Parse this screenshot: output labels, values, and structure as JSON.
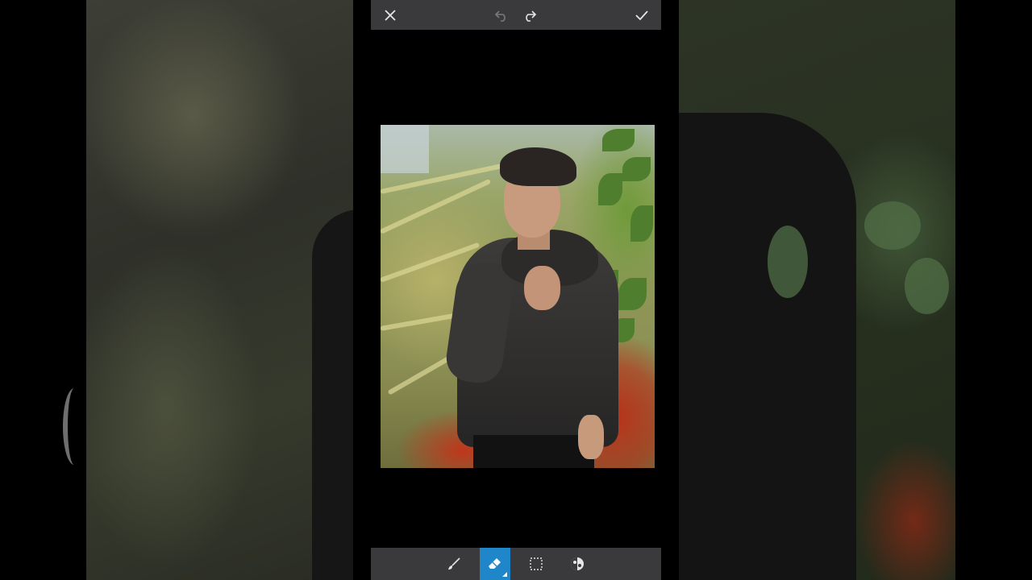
{
  "app": {
    "accent_color": "#1e86c9",
    "toolbar_color": "#3a3a3c"
  },
  "top_toolbar": {
    "close": {
      "icon": "close-icon"
    },
    "undo": {
      "icon": "undo-icon",
      "enabled": false
    },
    "redo": {
      "icon": "redo-icon",
      "enabled": true
    },
    "apply": {
      "icon": "checkmark-icon"
    }
  },
  "canvas": {
    "image": "photo-of-person-in-black-hoodie-with-foliage-background"
  },
  "bottom_toolbar": {
    "tools": [
      {
        "name": "brush",
        "icon": "brush-icon",
        "active": false
      },
      {
        "name": "eraser",
        "icon": "eraser-icon",
        "active": true
      },
      {
        "name": "selection",
        "icon": "selection-rect-icon",
        "active": false
      },
      {
        "name": "invert",
        "icon": "invert-icon",
        "active": false
      }
    ]
  }
}
